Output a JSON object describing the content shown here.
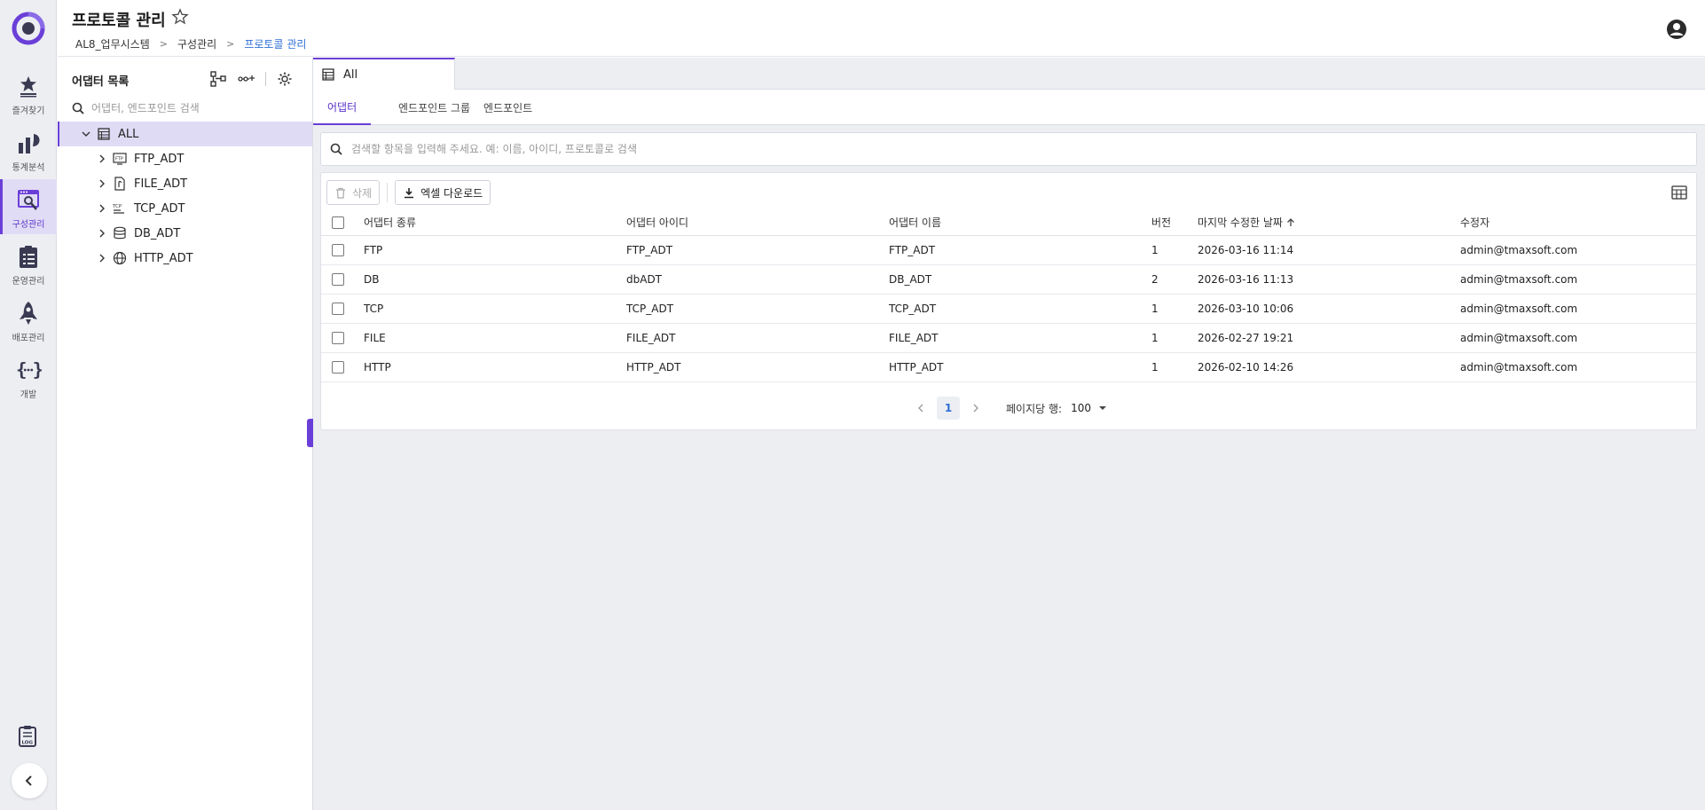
{
  "header": {
    "title": "프로토콜 관리",
    "breadcrumb": [
      "AL8_업무시스템",
      "구성관리",
      "프로토콜 관리"
    ]
  },
  "rail": {
    "items": [
      {
        "label": "즐겨찾기",
        "icon": "star-list-icon"
      },
      {
        "label": "통계분석",
        "icon": "stats-icon"
      },
      {
        "label": "구성관리",
        "icon": "config-icon",
        "active": true
      },
      {
        "label": "운영관리",
        "icon": "operations-icon"
      },
      {
        "label": "배포관리",
        "icon": "rocket-icon"
      },
      {
        "label": "개발",
        "icon": "code-icon"
      }
    ],
    "log_label": "LOG"
  },
  "tree": {
    "title": "어댑터 목록",
    "search_placeholder": "어댑터, 엔드포인트 검색",
    "root": "ALL",
    "children": [
      {
        "label": "FTP_ADT",
        "icon": "ftp-icon"
      },
      {
        "label": "FILE_ADT",
        "icon": "file-icon"
      },
      {
        "label": "TCP_ADT",
        "icon": "tcp-icon"
      },
      {
        "label": "DB_ADT",
        "icon": "database-icon"
      },
      {
        "label": "HTTP_ADT",
        "icon": "globe-icon"
      }
    ]
  },
  "main": {
    "doc_tab": "All",
    "sub_tabs": [
      "어댑터",
      "엔드포인트 그룹",
      "엔드포인트"
    ],
    "active_sub_tab": 0,
    "search_placeholder": "검색할 항목을 입력해 주세요. 예: 이름, 아이디, 프로토콜로 검색",
    "toolbar": {
      "delete_label": "삭제",
      "excel_label": "엑셀 다운로드"
    },
    "table": {
      "columns": [
        "어댑터 종류",
        "어댑터 아이디",
        "어댑터 이름",
        "버전",
        "마지막 수정한 날짜",
        "수정자"
      ],
      "rows": [
        [
          "FTP",
          "FTP_ADT",
          "FTP_ADT",
          "1",
          "2026-03-16 11:14",
          "admin@tmaxsoft.com"
        ],
        [
          "DB",
          "dbADT",
          "DB_ADT",
          "2",
          "2026-03-16 11:13",
          "admin@tmaxsoft.com"
        ],
        [
          "TCP",
          "TCP_ADT",
          "TCP_ADT",
          "1",
          "2026-03-10 10:06",
          "admin@tmaxsoft.com"
        ],
        [
          "FILE",
          "FILE_ADT",
          "FILE_ADT",
          "1",
          "2026-02-27 19:21",
          "admin@tmaxsoft.com"
        ],
        [
          "HTTP",
          "HTTP_ADT",
          "HTTP_ADT",
          "1",
          "2026-02-10 14:26",
          "admin@tmaxsoft.com"
        ]
      ]
    },
    "pagination": {
      "current_page": "1",
      "rows_label": "페이지당 행:",
      "rows_per_page": "100"
    }
  },
  "colors": {
    "accent": "#6a3fd8",
    "link": "#2f6fd6",
    "rail_bg": "#eceef2"
  }
}
